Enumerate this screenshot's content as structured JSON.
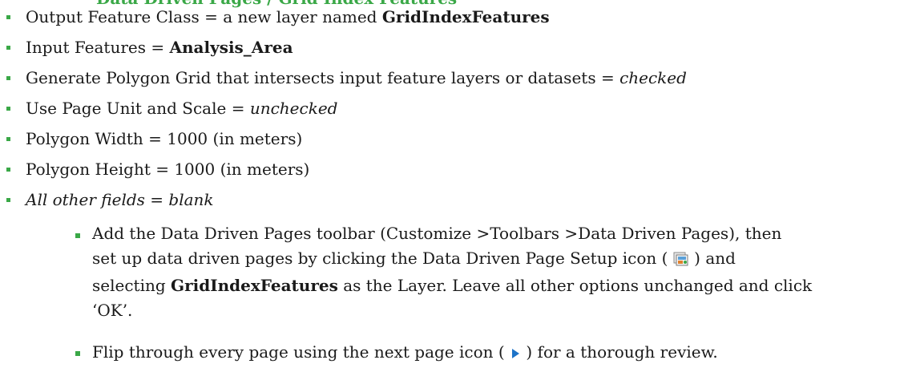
{
  "header_fragment": "Data Driven Pages / Grid Index Features",
  "list": [
    {
      "pre": "Output Feature Class = a new layer named ",
      "bold": "GridIndexFeatures",
      "post": ""
    },
    {
      "pre": "Input Features = ",
      "bold": "Analysis_Area",
      "post": ""
    },
    {
      "pre": "Generate Polygon Grid that intersects input feature layers or datasets = ",
      "italic": "checked"
    },
    {
      "pre": "Use Page Unit and Scale = ",
      "italic": "unchecked"
    },
    {
      "pre": "Polygon Width = 1000 (in meters)"
    },
    {
      "pre": "Polygon Height = 1000 (in meters)"
    },
    {
      "italic_all": "All other fields = blank"
    }
  ],
  "steps": {
    "step1": {
      "t1": "Add the Data Driven Pages toolbar (Customize >Toolbars >Data Driven Pages), then",
      "t2a": "set up data driven pages by clicking the Data Driven Page Setup icon ( ",
      "icon1": "data-driven-page-setup-icon",
      "t2b": " ) and",
      "t3a": "selecting ",
      "t3b": "GridIndexFeatures",
      "t3c": " as the Layer. Leave all other options unchanged and click",
      "t4": "‘OK’."
    },
    "step2": {
      "t1a": "Flip through every page using the next page icon ( ",
      "icon2": "next-page-icon",
      "t1b": " ) for a thorough review."
    }
  },
  "colors": {
    "bullet": "#3aa847",
    "text": "#1a1a1a",
    "next_icon": "#1e73c8"
  }
}
